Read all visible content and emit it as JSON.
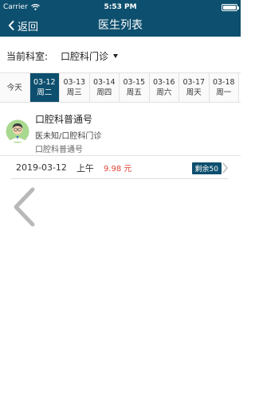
{
  "status_bar": {
    "carrier": "Carrier",
    "time": "5:53 PM",
    "battery_level": 1.0
  },
  "nav": {
    "back_label": "返回",
    "title": "医生列表"
  },
  "department": {
    "label": "当前科室:",
    "value": "口腔科门诊"
  },
  "dates": [
    {
      "date": "今天",
      "weekday": ""
    },
    {
      "date": "03-12",
      "weekday": "周二",
      "selected": true
    },
    {
      "date": "03-13",
      "weekday": "周三"
    },
    {
      "date": "03-14",
      "weekday": "周四"
    },
    {
      "date": "03-15",
      "weekday": "周五"
    },
    {
      "date": "03-16",
      "weekday": "周六"
    },
    {
      "date": "03-17",
      "weekday": "周天"
    },
    {
      "date": "03-18",
      "weekday": "周一"
    }
  ],
  "doctor": {
    "name": "口腔科普通号",
    "department": "医未知/口腔科门诊",
    "specialty": "口腔科普通号"
  },
  "slot": {
    "date": "2019-03-12",
    "period": "上午",
    "price": "9.98 元",
    "remaining": "剩余50"
  },
  "colors": {
    "primary": "#0d4f6e",
    "price": "#e0473a"
  },
  "icons": {
    "back": "chevron-left-icon",
    "dropdown": "caret-down-icon",
    "avatar": "doctor-avatar",
    "large_back": "large-chevron-left-icon"
  }
}
